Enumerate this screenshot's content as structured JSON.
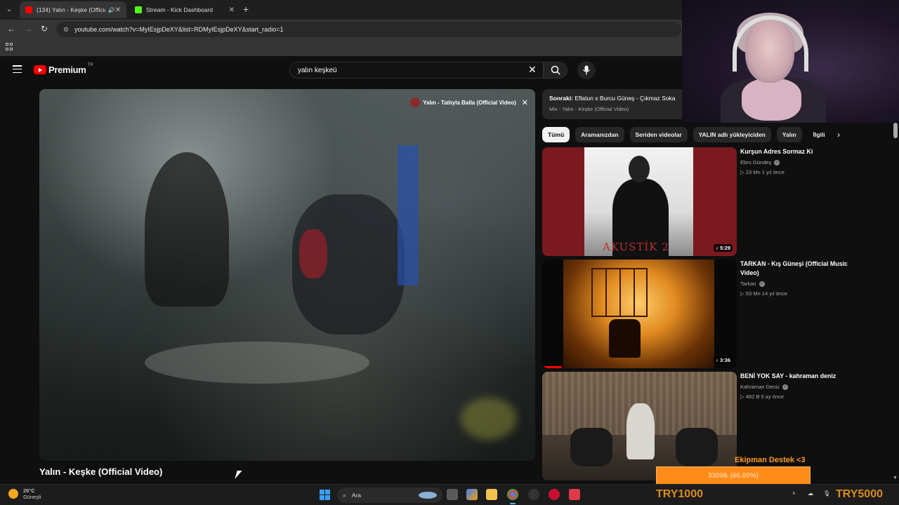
{
  "browser": {
    "tabs": [
      {
        "label": "(134) Yalın - Keşke (Official V",
        "active": true
      },
      {
        "label": "Stream - Kick Dashboard",
        "active": false
      }
    ],
    "new_tab": "+",
    "url": "youtube.com/watch?v=MyIEsjpDeXY&list=RDMyIEsjpDeXY&start_radio=1"
  },
  "youtube": {
    "logo_text": "Premium",
    "country": "TR",
    "search_value": "yalın keşkeü"
  },
  "player": {
    "endcard_text": "Yalın - Tatlıyla Balla (Official Video)",
    "video_title": "Yalın - Keşke (Official Video)"
  },
  "up_next": {
    "prefix": "Sonraki:",
    "title": "Eflatun x Burcu Güneş - Çıkmaz Sokak",
    "playlist": "Mix - Yalın - Keşke (Official Video)"
  },
  "chips": [
    "Tümü",
    "Aramanızdan",
    "Seriden videolar",
    "YALIN adlı yükleyiciden",
    "Yalın",
    "İlgili"
  ],
  "recommendations": [
    {
      "title": "Kurşun Adres Sormaz Ki",
      "channel": "Ebru Gündeş",
      "stats": "▷ 23 Mn  1 yıl önce",
      "duration": "♪ 5:29",
      "thumb_text": "AKUSTİK 2"
    },
    {
      "title": "TARKAN - Kış Güneşi (Official Music Video)",
      "channel": "Tarkan",
      "stats": "▷ 53 Mn  14 yıl önce",
      "duration": "♪ 3:36"
    },
    {
      "title": "BENİ YOK SAY - kahraman deniz",
      "channel": "Kahraman Deniz",
      "stats": "▷ 482 B  5 ay önce",
      "duration": ""
    }
  ],
  "donation": {
    "title": "Ekipman Destek <3",
    "progress_text": "3300₺ (66.00%)",
    "progress_fraction": 0.66,
    "current": "TRY1000",
    "goal": "TRY5000"
  },
  "taskbar": {
    "temperature": "26°C",
    "weather": "Güneşli",
    "search": "Ara"
  },
  "colors": {
    "yt_red": "#ff0000",
    "donation_orange": "#ff8c1a",
    "background": "#0f0f0f"
  }
}
